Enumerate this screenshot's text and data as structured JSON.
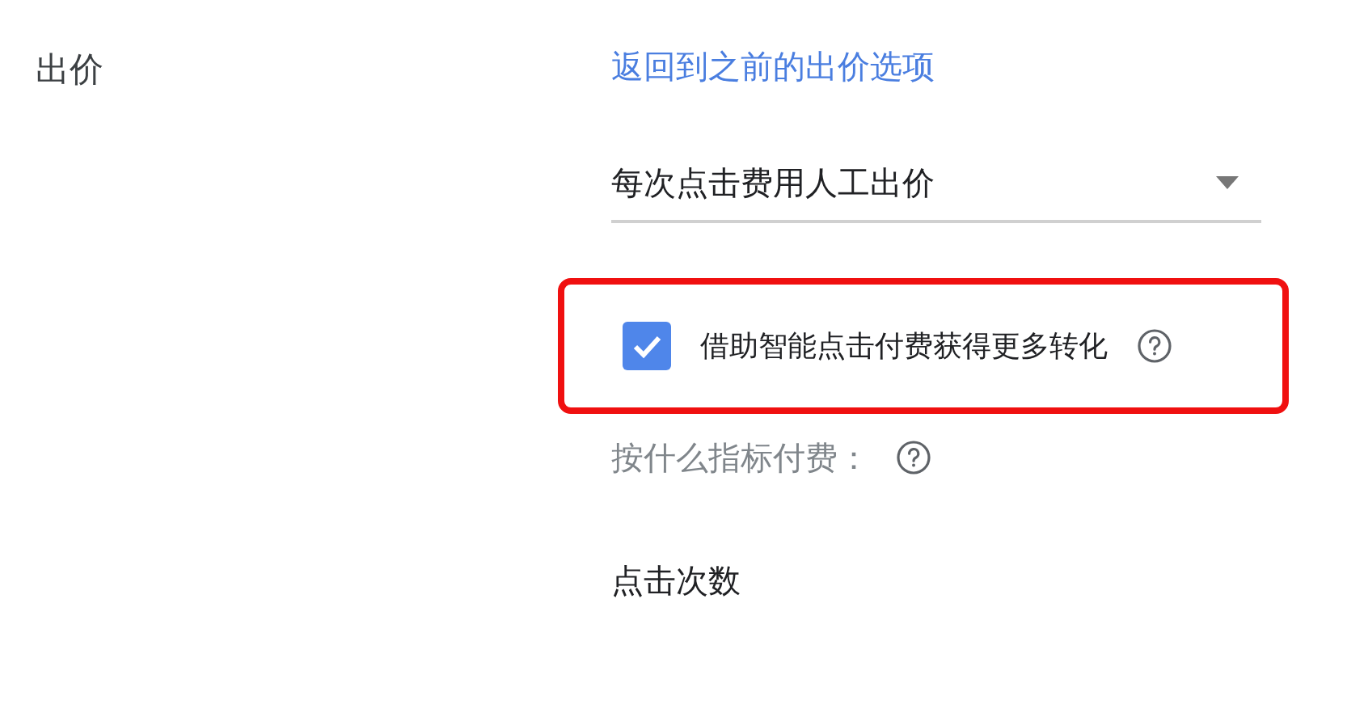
{
  "section_label": "出价",
  "back_link": "返回到之前的出价选项",
  "bid_strategy": {
    "value": "每次点击费用人工出价"
  },
  "enhanced_cpc": {
    "label": "借助智能点击付费获得更多转化",
    "checked": true,
    "highlighted": true
  },
  "pay_for": {
    "label": "按什么指标付费：",
    "value": "点击次数"
  }
}
